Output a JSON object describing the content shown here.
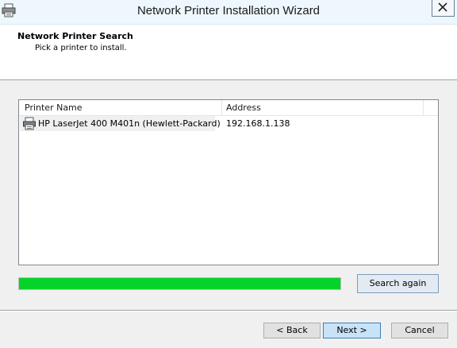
{
  "window": {
    "title": "Network Printer Installation Wizard"
  },
  "header": {
    "title": "Network Printer Search",
    "subtitle": "Pick a printer to install."
  },
  "printer_list": {
    "columns": [
      "Printer Name",
      "Address"
    ],
    "rows": [
      {
        "name": "HP LaserJet 400 M401n (Hewlett-Packard)",
        "address": "192.168.1.138",
        "icon": "printer-icon"
      }
    ]
  },
  "progress": {
    "value_percent": 100,
    "color": "#06d32a"
  },
  "buttons": {
    "search_again": "Search again",
    "back": "< Back",
    "next": "Next >",
    "cancel": "Cancel"
  }
}
